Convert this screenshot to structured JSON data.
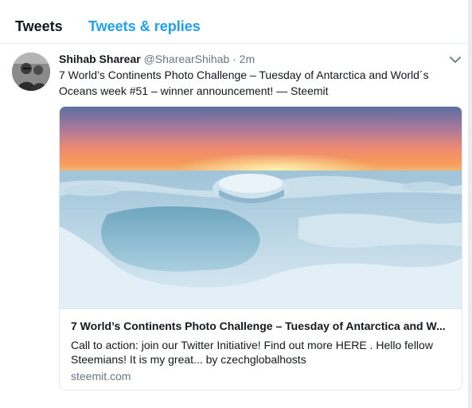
{
  "tabs": {
    "tweets": "Tweets",
    "replies": "Tweets & replies"
  },
  "tweet": {
    "fullname": "Shihab Sharear",
    "username": "@SharearShihab",
    "separator": "·",
    "time": "2m",
    "text": "7 World’s Continents Photo Challenge – Tuesday of Antarctica and World´s Oceans week #51 – winner announcement! — Steemit",
    "avatar_icon": "profile-photo",
    "caret_icon": "chevron-down-icon",
    "card": {
      "image_description_icon": "antarctica-sunset-photo",
      "title": "7 World’s Continents Photo Challenge – Tuesday of Antarctica and W...",
      "description": "Call to action: join our Twitter Initiative! Find out more HERE . Hello fellow Steemians! It is my great... by czechglobalhosts",
      "domain": "steemit.com"
    }
  },
  "colors": {
    "accent": "#1da1f2",
    "secondary_text": "#657786",
    "border": "#e1e8ed",
    "background": "#e6ecf0"
  }
}
